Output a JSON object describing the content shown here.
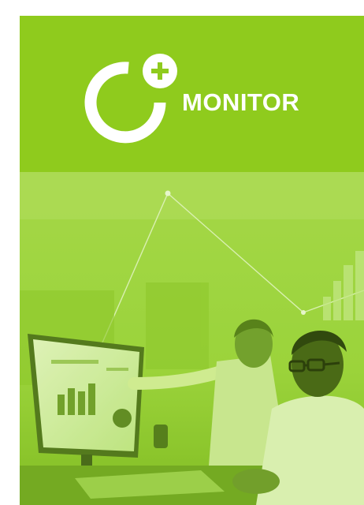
{
  "brand": {
    "name": "MONITOR",
    "logo_icon": "plus-ring-logo-icon",
    "logo_symbol": "+"
  },
  "hero": {
    "image": "team-at-monitor-photo",
    "description_icons": [
      "monitor-dashboard-icon",
      "person-pointing-icon",
      "person-with-glasses-icon"
    ]
  },
  "colors": {
    "brand_green": "#8fcb1d",
    "photo_tint": "#9ad33a",
    "white": "#ffffff"
  }
}
